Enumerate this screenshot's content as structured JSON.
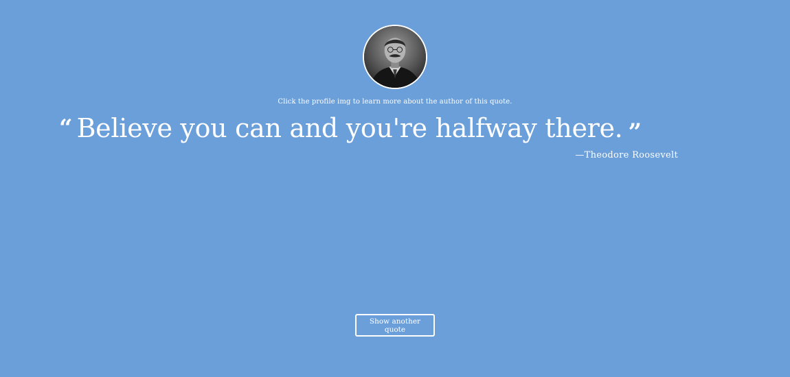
{
  "profile": {
    "image_alt": "Theodore Roosevelt profile image",
    "hint": "Click the profile img to learn more about the author of this quote."
  },
  "quote": {
    "open_mark": "“",
    "text": "Believe you can and you're halfway there.",
    "close_mark": "”",
    "author": "—Theodore Roosevelt"
  },
  "actions": {
    "next_label": "Show another quote"
  },
  "colors": {
    "background": "#6b9fda",
    "foreground": "#ffffff"
  }
}
